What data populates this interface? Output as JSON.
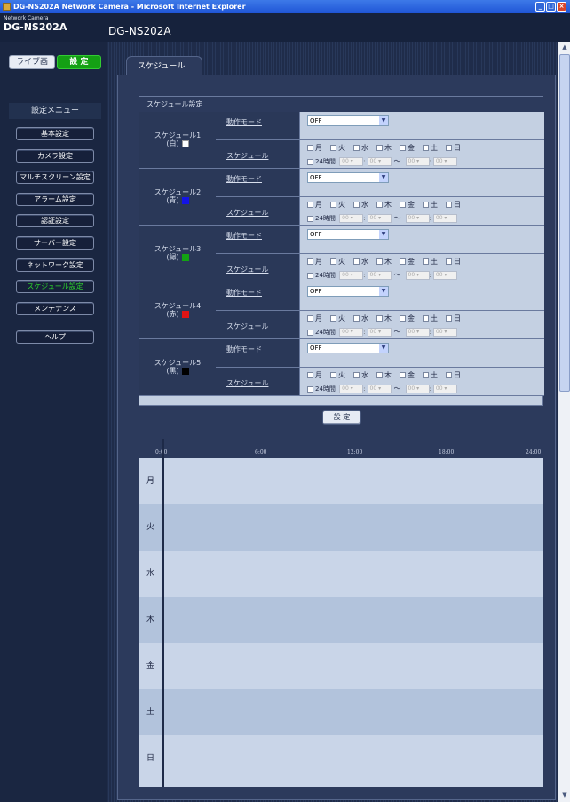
{
  "window": {
    "title": "DG-NS202A Network Camera - Microsoft Internet Explorer"
  },
  "header": {
    "brand_small": "Network Camera",
    "brand_big": "DG-NS202A",
    "model": "DG-NS202A"
  },
  "top_buttons": {
    "live": "ライブ画",
    "setup": "設 定"
  },
  "menu": {
    "title": "設定メニュー",
    "items": [
      "基本設定",
      "カメラ設定",
      "マルチスクリーン設定",
      "アラーム設定",
      "認証設定",
      "サーバー設定",
      "ネットワーク設定",
      "スケジュール設定",
      "メンテナンス",
      "ヘルプ"
    ],
    "active_index": 7
  },
  "tab": {
    "label": "スケジュール"
  },
  "form": {
    "title": "スケジュール設定",
    "mode_label": "動作モード",
    "schedule_label": "スケジュール",
    "days": [
      "月",
      "火",
      "水",
      "木",
      "金",
      "土",
      "日"
    ],
    "all_day_label": "24時間",
    "time_placeholder": "00",
    "tilde": "～",
    "groups": [
      {
        "name": "スケジュール1",
        "color_label": "(白)",
        "color": "#ffffff",
        "mode": "OFF"
      },
      {
        "name": "スケジュール2",
        "color_label": "(青)",
        "color": "#1414e6",
        "mode": "OFF"
      },
      {
        "name": "スケジュール3",
        "color_label": "(緑)",
        "color": "#13a313",
        "mode": "OFF"
      },
      {
        "name": "スケジュール4",
        "color_label": "(赤)",
        "color": "#e01414",
        "mode": "OFF"
      },
      {
        "name": "スケジュール5",
        "color_label": "(黒)",
        "color": "#000000",
        "mode": "OFF"
      }
    ]
  },
  "set_button": "設 定",
  "timeline": {
    "ticks": [
      "0:00",
      "6:00",
      "12:00",
      "18:00",
      "24:00"
    ],
    "days": [
      "月",
      "火",
      "水",
      "木",
      "金",
      "土",
      "日"
    ]
  },
  "colors": {
    "accent_green": "#14a014",
    "panel": "#2c3a5c",
    "form_bg": "#c4d0e2"
  }
}
